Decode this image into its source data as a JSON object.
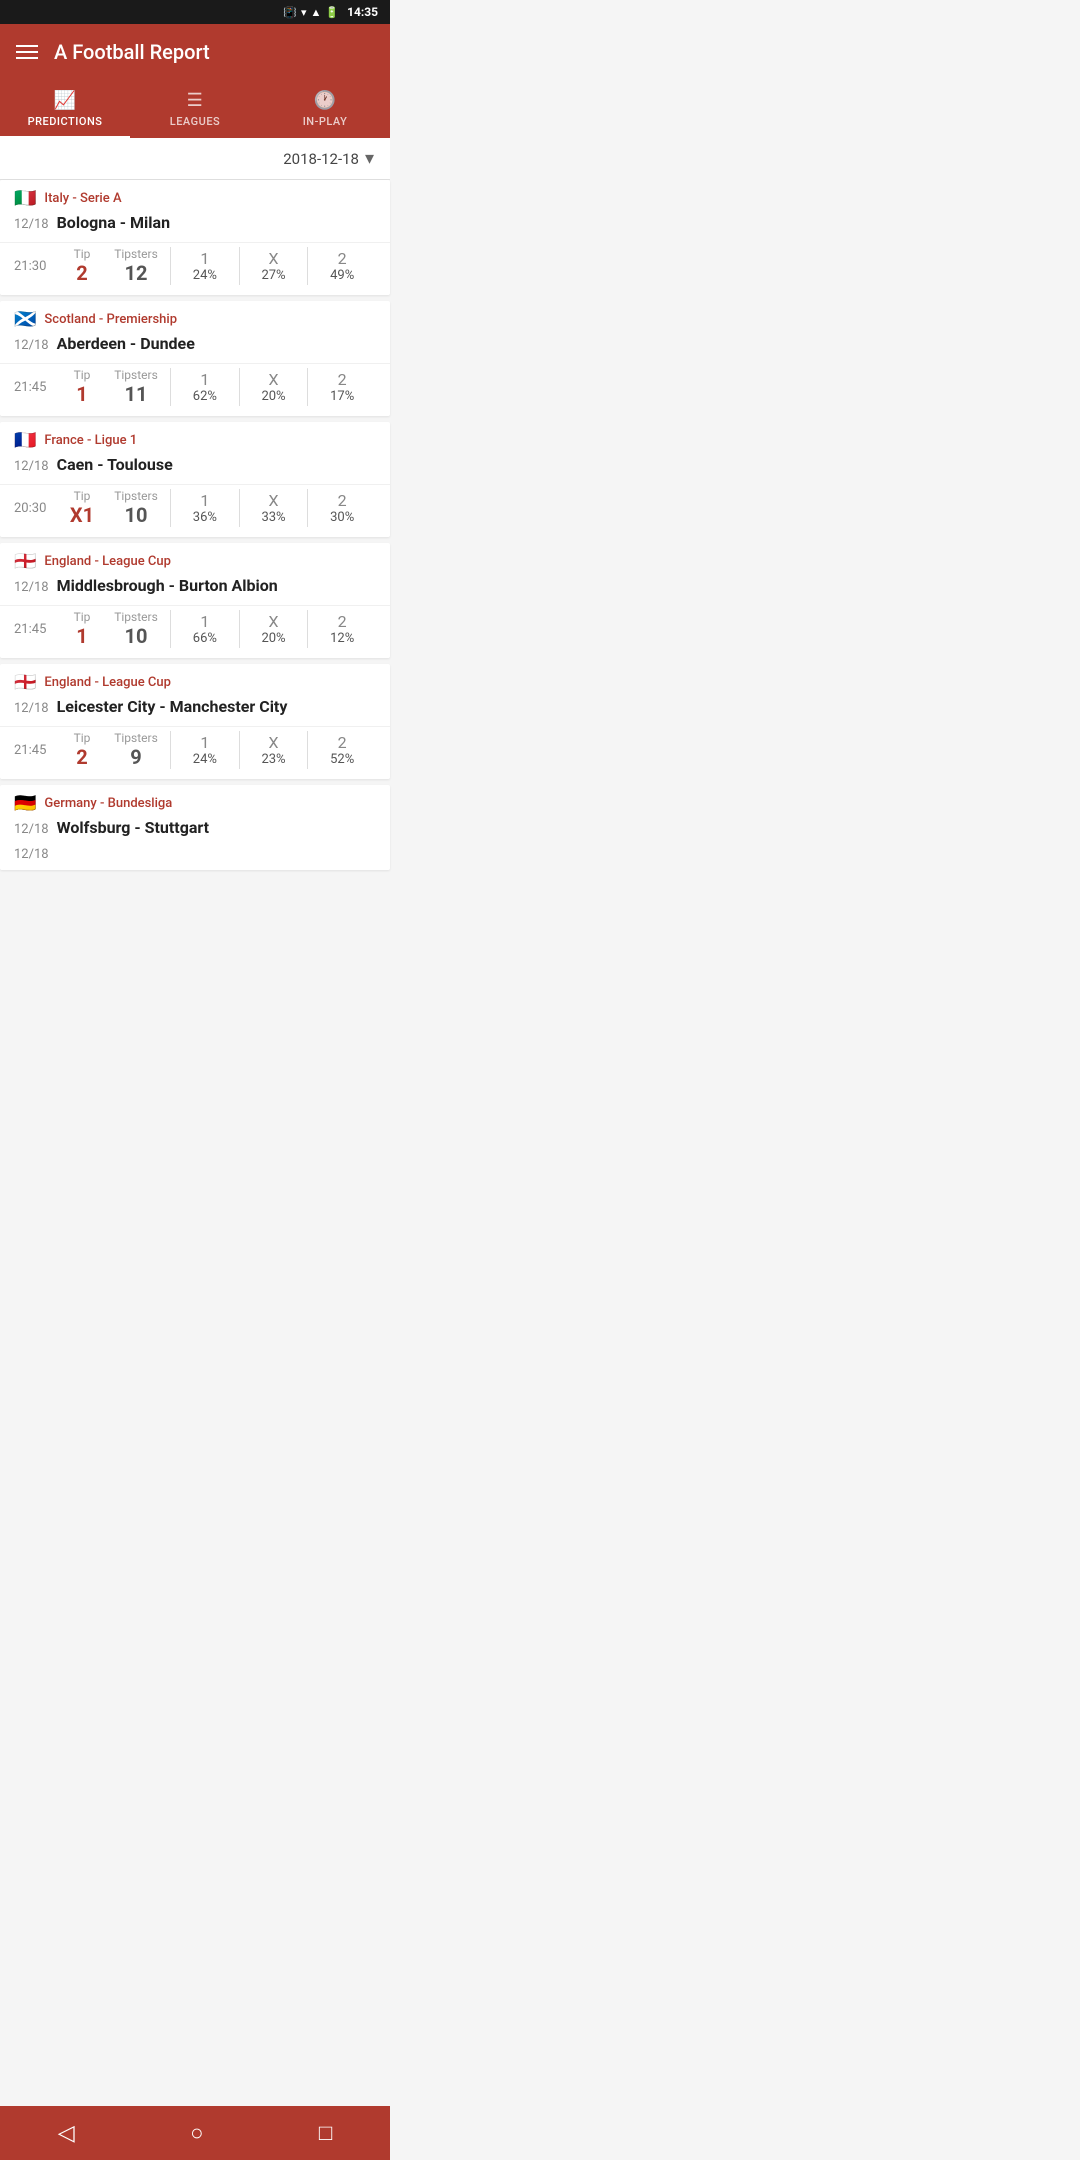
{
  "statusBar": {
    "time": "14:35",
    "icons": [
      "vibrate",
      "wifi",
      "signal",
      "battery"
    ]
  },
  "header": {
    "title": "A Football Report"
  },
  "tabs": [
    {
      "id": "predictions",
      "label": "PREDICTIONS",
      "icon": "📈",
      "active": true
    },
    {
      "id": "leagues",
      "label": "LEAGUES",
      "icon": "☰",
      "active": false
    },
    {
      "id": "inplay",
      "label": "IN-PLAY",
      "icon": "🕐",
      "active": false
    }
  ],
  "dateSelector": {
    "value": "2018-12-18"
  },
  "matches": [
    {
      "id": "match-1",
      "flag": "🇮🇹",
      "league": "Italy - Serie A",
      "date": "12/18",
      "name": "Bologna - Milan",
      "time": "21:30",
      "tip": "2",
      "tipsters": "12",
      "odds": [
        {
          "label": "1",
          "pct": "24%"
        },
        {
          "label": "X",
          "pct": "27%"
        },
        {
          "label": "2",
          "pct": "49%"
        }
      ]
    },
    {
      "id": "match-2",
      "flag": "🏴󠁧󠁢󠁳󠁣󠁴󠁿",
      "league": "Scotland - Premiership",
      "date": "12/18",
      "name": "Aberdeen - Dundee",
      "time": "21:45",
      "tip": "1",
      "tipsters": "11",
      "odds": [
        {
          "label": "1",
          "pct": "62%"
        },
        {
          "label": "X",
          "pct": "20%"
        },
        {
          "label": "2",
          "pct": "17%"
        }
      ]
    },
    {
      "id": "match-3",
      "flag": "🇫🇷",
      "league": "France - Ligue 1",
      "date": "12/18",
      "name": "Caen - Toulouse",
      "time": "20:30",
      "tip": "X1",
      "tipsters": "10",
      "odds": [
        {
          "label": "1",
          "pct": "36%"
        },
        {
          "label": "X",
          "pct": "33%"
        },
        {
          "label": "2",
          "pct": "30%"
        }
      ]
    },
    {
      "id": "match-4",
      "flag": "🏴󠁧󠁢󠁥󠁮󠁧󠁿",
      "league": "England - League Cup",
      "date": "12/18",
      "name": "Middlesbrough - Burton Albion",
      "time": "21:45",
      "tip": "1",
      "tipsters": "10",
      "odds": [
        {
          "label": "1",
          "pct": "66%"
        },
        {
          "label": "X",
          "pct": "20%"
        },
        {
          "label": "2",
          "pct": "12%"
        }
      ]
    },
    {
      "id": "match-5",
      "flag": "🏴󠁧󠁢󠁥󠁮󠁧󠁿",
      "league": "England - League Cup",
      "date": "12/18",
      "name": "Leicester City - Manchester City",
      "time": "21:45",
      "tip": "2",
      "tipsters": "9",
      "odds": [
        {
          "label": "1",
          "pct": "24%"
        },
        {
          "label": "X",
          "pct": "23%"
        },
        {
          "label": "2",
          "pct": "52%"
        }
      ]
    },
    {
      "id": "match-6",
      "flag": "🇩🇪",
      "league": "Germany - Bundesliga",
      "date": "12/18",
      "name": "Wolfsburg - Stuttgart",
      "time": "",
      "tip": "",
      "tipsters": "",
      "odds": []
    }
  ],
  "bottomNav": {
    "back": "◁",
    "home": "○",
    "square": "□"
  }
}
